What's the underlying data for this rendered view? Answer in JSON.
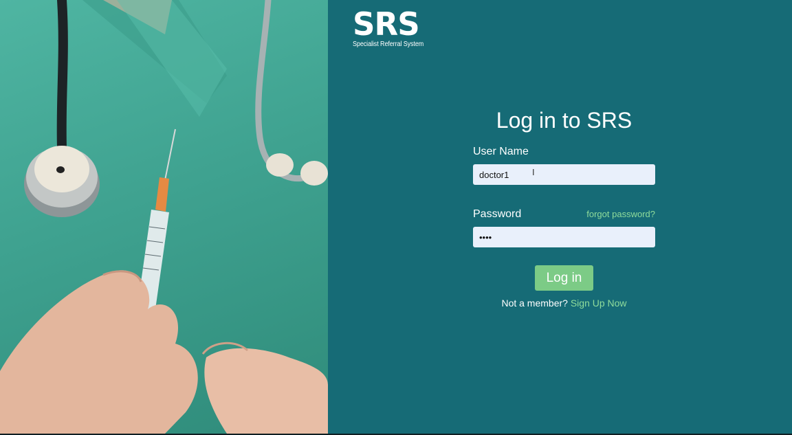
{
  "brand": {
    "logo": "SRS",
    "tagline": "Specialist Referral System"
  },
  "login": {
    "title": "Log in to SRS",
    "username_label": "User Name",
    "username_value": "doctor1",
    "password_label": "Password",
    "password_value": "••••",
    "forgot_link": "forgot password?",
    "submit_label": "Log in",
    "signup_prompt": "Not a member?",
    "signup_link": "Sign Up Now"
  },
  "colors": {
    "panel_background": "#166b76",
    "accent_green": "#7ccb86",
    "link_green": "#8fdc9b",
    "input_background": "#e9f0fb",
    "scrubs": "#46ab98"
  },
  "icons": {
    "text_cursor": "i-beam-cursor-icon"
  }
}
